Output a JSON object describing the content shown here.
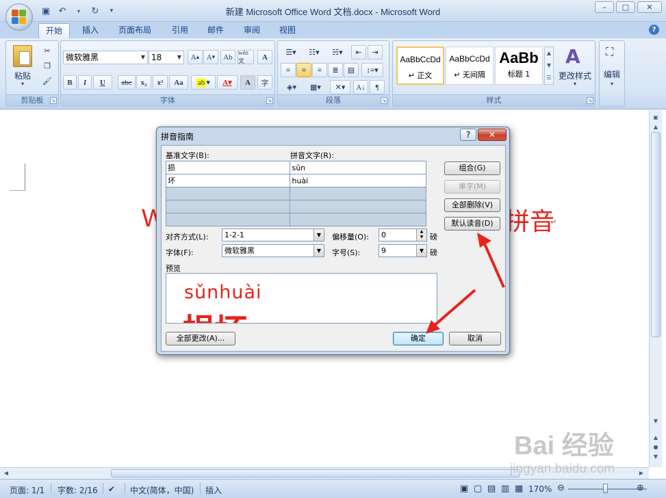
{
  "window": {
    "title": "新建 Microsoft Office Word 文档.docx - Microsoft Word",
    "minimize": "–",
    "maximize": "□",
    "close": "✕"
  },
  "ribbon": {
    "tabs": [
      "开始",
      "插入",
      "页面布局",
      "引用",
      "邮件",
      "审阅",
      "视图"
    ],
    "active_tab": "开始",
    "groups": {
      "clipboard": {
        "label": "剪贴板",
        "paste": "粘贴"
      },
      "font": {
        "label": "字体",
        "font_name": "微软雅黑",
        "font_size": "18",
        "bold": "B",
        "italic": "I",
        "underline": "U",
        "strikethrough": "abc",
        "subscript": "x₂",
        "superscript": "x²",
        "change_case": "Aa",
        "phonetic_guide": "wén 文",
        "enclose": "字"
      },
      "paragraph": {
        "label": "段落"
      },
      "styles": {
        "label": "样式",
        "items": [
          {
            "sample": "AaBbCcDd",
            "name": "↵ 正文"
          },
          {
            "sample": "AaBbCcDd",
            "name": "↵ 无间隔"
          },
          {
            "sample": "AaBb",
            "name": "标题 1"
          }
        ],
        "change_styles": "更改样式"
      },
      "editing": {
        "label": "编辑"
      }
    }
  },
  "document": {
    "visible_text_left": "W",
    "visible_text_right": "拼音",
    "para_mark": "↵"
  },
  "dialog": {
    "title": "拼音指南",
    "help": "?",
    "base_text_label": "基准文字(B):",
    "ruby_text_label": "拼音文字(R):",
    "rows": [
      {
        "base": "损",
        "ruby": "sǔn"
      },
      {
        "base": "坏",
        "ruby": "huài"
      }
    ],
    "buttons": {
      "group": "组合(G)",
      "mono": "单字(M)",
      "clear_all": "全部删除(V)",
      "default_reading": "默认读音(D)",
      "apply_all": "全部更改(A)...",
      "ok": "确定",
      "cancel": "取消"
    },
    "alignment_label": "对齐方式(L):",
    "alignment_value": "1-2-1",
    "offset_label": "偏移量(O):",
    "offset_value": "0",
    "offset_unit": "磅",
    "font_label": "字体(F):",
    "font_value": "微软雅黑",
    "size_label": "字号(S):",
    "size_value": "9",
    "size_unit": "磅",
    "preview_label": "预览",
    "preview_pinyin": "sǔnhuài",
    "preview_chars": "损坏"
  },
  "statusbar": {
    "page": "页面: 1/1",
    "words": "字数: 2/16",
    "language": "中文(简体，中国)",
    "insert_mode": "插入",
    "zoom": "170%"
  },
  "watermark": {
    "brand": "Bai 经验",
    "url": "jingyan.baidu.com"
  },
  "colors": {
    "accent_red": "#e8231a",
    "ribbon_blue": "#dce8f6",
    "dialog_frame": "#c9d8ea"
  }
}
